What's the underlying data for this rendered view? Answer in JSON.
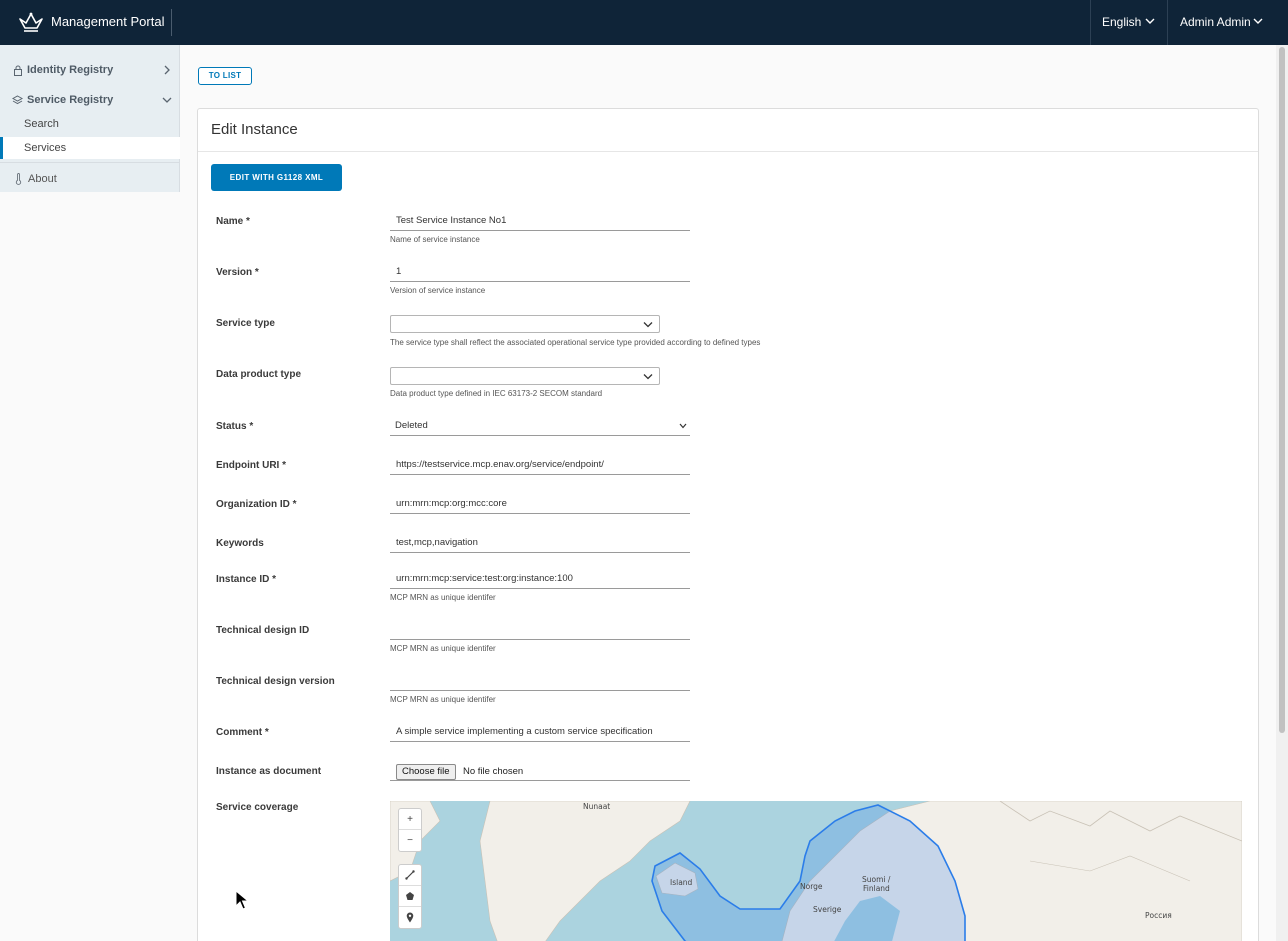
{
  "header": {
    "app_title": "Management Portal",
    "language": "English",
    "user": "Admin Admin",
    "logo_icon": "crown-icon",
    "bg_color": "#0f2438"
  },
  "sidebar": {
    "groups": [
      {
        "label": "Identity Registry",
        "icon": "lock-icon",
        "expanded": false
      },
      {
        "label": "Service Registry",
        "icon": "layers-icon",
        "expanded": true
      }
    ],
    "items": [
      {
        "label": "Search",
        "active": false
      },
      {
        "label": "Services",
        "active": true
      }
    ],
    "about": {
      "label": "About",
      "icon": "thermometer-icon"
    }
  },
  "main": {
    "to_list_label": "TO LIST",
    "card_title": "Edit Instance",
    "xml_button_label": "EDIT WITH G1128 XML",
    "fields": {
      "name": {
        "label": "Name *",
        "value": "Test Service Instance No1",
        "help": "Name of service instance"
      },
      "version": {
        "label": "Version *",
        "value": "1",
        "help": "Version of service instance"
      },
      "service_type": {
        "label": "Service type",
        "value": "",
        "help": "The service type shall reflect the associated operational service type provided according to defined types"
      },
      "data_product_type": {
        "label": "Data product type",
        "value": "",
        "help": "Data product type defined in IEC 63173-2 SECOM standard"
      },
      "status": {
        "label": "Status *",
        "value": "Deleted"
      },
      "endpoint_uri": {
        "label": "Endpoint URI *",
        "value": "https://testservice.mcp.enav.org/service/endpoint/"
      },
      "organization_id": {
        "label": "Organization ID *",
        "value": "urn:mrn:mcp:org:mcc:core"
      },
      "keywords": {
        "label": "Keywords",
        "value": "test,mcp,navigation"
      },
      "instance_id": {
        "label": "Instance ID *",
        "value": "urn:mrn:mcp:service:test:org:instance:100",
        "help": "MCP MRN as unique identifer"
      },
      "technical_design_id": {
        "label": "Technical design ID",
        "value": "",
        "help": "MCP MRN as unique identifer"
      },
      "technical_design_version": {
        "label": "Technical design version",
        "value": "",
        "help": "MCP MRN as unique identifer"
      },
      "comment": {
        "label": "Comment *",
        "value": "A simple service implementing a custom service specification"
      },
      "instance_document": {
        "label": "Instance as document",
        "button": "Choose file",
        "status": "No file chosen"
      },
      "service_coverage": {
        "label": "Service coverage"
      }
    },
    "map": {
      "labels": {
        "nunaat": "Nunaat",
        "island": "Island",
        "norge": "Norge",
        "suomi": "Suomi /",
        "finland": "Finland",
        "sverige": "Sverige",
        "rossiya": "Россия"
      },
      "zoom_in": "+",
      "zoom_out": "−",
      "tools": [
        "line-icon",
        "polygon-icon",
        "marker-icon"
      ],
      "coverage_color": "#2b7de9"
    }
  },
  "accent_color": "#0079b8"
}
